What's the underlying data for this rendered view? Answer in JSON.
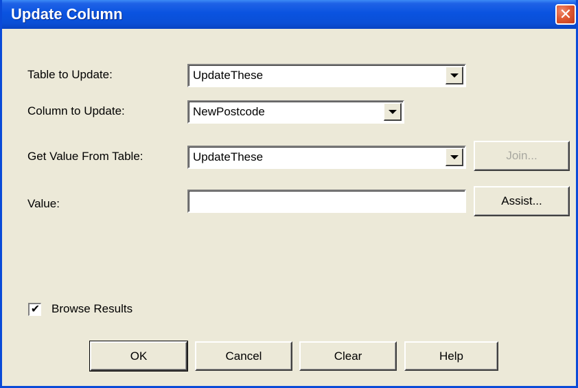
{
  "window": {
    "title": "Update Column",
    "close_glyph": "✕"
  },
  "form": {
    "table_to_update": {
      "label": "Table to Update:",
      "value": "UpdateThese"
    },
    "column_to_update": {
      "label": "Column to Update:",
      "value": "NewPostcode"
    },
    "get_value_from_table": {
      "label": "Get Value From Table:",
      "value": "UpdateThese"
    },
    "value": {
      "label": "Value:",
      "value": ""
    }
  },
  "buttons": {
    "join": "Join...",
    "assist": "Assist...",
    "ok": "OK",
    "cancel": "Cancel",
    "clear": "Clear",
    "help": "Help"
  },
  "browse_results": {
    "label": "Browse Results",
    "checked": true,
    "check_glyph": "✔"
  },
  "colors": {
    "titlebar": "#0a53e0",
    "dialog_bg": "#ece9d8",
    "close_button": "#e05a33"
  },
  "icons": {
    "close": "close-icon",
    "dropdown": "chevron-down-icon",
    "checkbox": "checkmark-icon"
  }
}
